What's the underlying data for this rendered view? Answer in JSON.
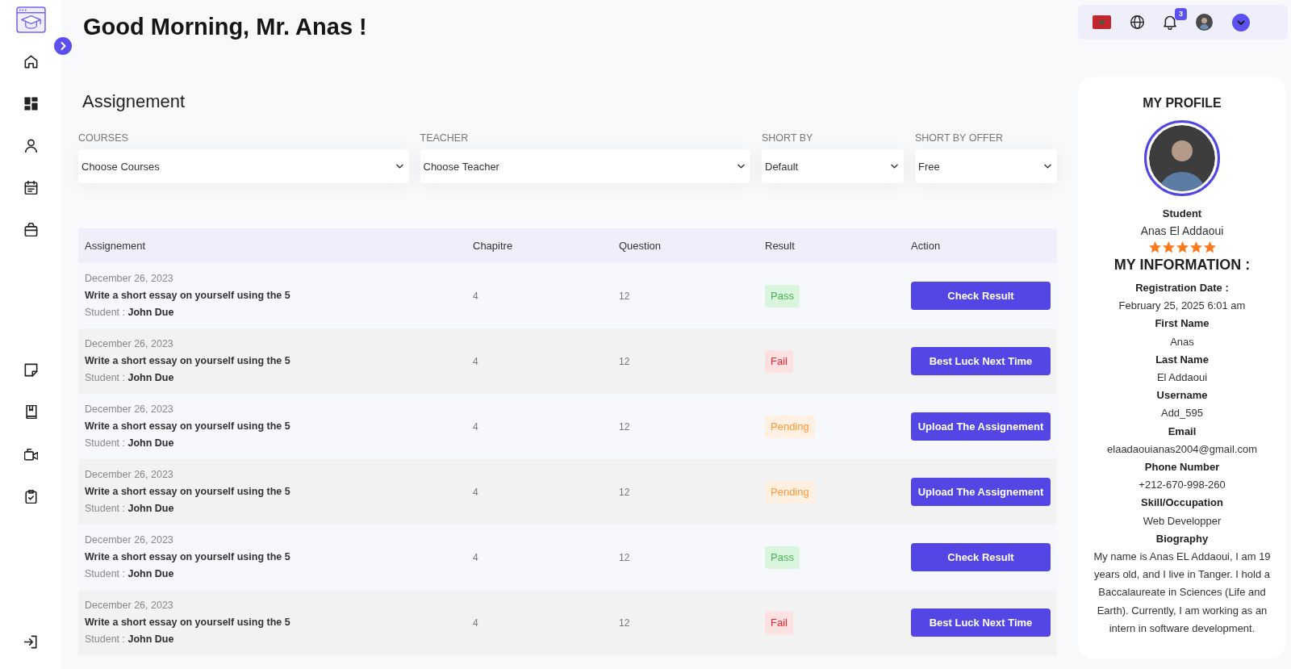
{
  "sidebar": {
    "groups": [
      [
        {
          "kind": "home"
        },
        {
          "kind": "grid"
        },
        {
          "kind": "user"
        },
        {
          "kind": "calendar"
        },
        {
          "kind": "bag"
        }
      ],
      [
        {
          "kind": "note"
        },
        {
          "kind": "book"
        },
        {
          "kind": "video"
        },
        {
          "kind": "clipboard"
        }
      ],
      [
        {
          "kind": "exit"
        }
      ]
    ]
  },
  "header": {
    "greeting": "Good Morning, Mr. Anas !"
  },
  "topbar": {
    "notifications": "3"
  },
  "section_title": "Assignement",
  "filters": [
    {
      "label": "COURSES",
      "value": "Choose Courses"
    },
    {
      "label": "TEACHER",
      "value": "Choose Teacher"
    },
    {
      "label": "SHORT BY",
      "value": "Default"
    },
    {
      "label": "SHORT BY OFFER",
      "value": "Free"
    }
  ],
  "table": {
    "columns": [
      "Assignement",
      "Chapitre",
      "Question",
      "Result",
      "Action"
    ],
    "rows": [
      {
        "date": "December 26, 2023",
        "title": "Write a short essay on yourself using the 5",
        "student": "Student : **John Due**",
        "chapter": "4",
        "question": "12",
        "result": {
          "text": "Pass",
          "kind": "pass"
        },
        "action": "Check Result"
      },
      {
        "date": "December 26, 2023",
        "title": "Write a short essay on yourself using the 5",
        "student": "Student : **John Due**",
        "chapter": "4",
        "question": "12",
        "result": {
          "text": "Fail",
          "kind": "fail"
        },
        "action": "Best Luck Next Time"
      },
      {
        "date": "December 26, 2023",
        "title": "Write a short essay on yourself using the 5",
        "student": "Student : **John Due**",
        "chapter": "4",
        "question": "12",
        "result": {
          "text": "Pending",
          "kind": "pending"
        },
        "action": "Upload The Assignement"
      },
      {
        "date": "December 26, 2023",
        "title": "Write a short essay on yourself using the 5",
        "student": "Student : **John Due**",
        "chapter": "4",
        "question": "12",
        "result": {
          "text": "Pending",
          "kind": "pending"
        },
        "action": "Upload The Assignement"
      },
      {
        "date": "December 26, 2023",
        "title": "Write a short essay on yourself using the 5",
        "student": "Student : **John Due**",
        "chapter": "4",
        "question": "12",
        "result": {
          "text": "Pass",
          "kind": "pass"
        },
        "action": "Check Result"
      },
      {
        "date": "December 26, 2023",
        "title": "Write a short essay on yourself using the 5",
        "student": "Student : **John Due**",
        "chapter": "4",
        "question": "12",
        "result": {
          "text": "Fail",
          "kind": "fail"
        },
        "action": "Best Luck Next Time"
      }
    ]
  },
  "profile": {
    "title": "MY PROFILE",
    "role": "Student",
    "name": "Anas El Addaoui",
    "stars": 5,
    "info_title": "MY INFORMATION :",
    "fields": [
      {
        "label": "Registration Date :",
        "value": "February 25, 2025 6:01 am"
      },
      {
        "label": "First Name",
        "value": "Anas"
      },
      {
        "label": "Last Name",
        "value": "El Addaoui"
      },
      {
        "label": "Username",
        "value": "Add_595"
      },
      {
        "label": "Email",
        "value": "elaadaouianas2004@gmail.com"
      },
      {
        "label": "Phone Number",
        "value": "+212-670-998-260"
      },
      {
        "label": "Skill/Occupation",
        "value": "Web Developper"
      },
      {
        "label": "Biography",
        "value": "My name is Anas EL Addaoui, I am 19 years old, and I live in Tanger. I hold a Baccalaureate in Sciences (Life and Earth). Currently, I am working as an intern in software development."
      }
    ]
  }
}
